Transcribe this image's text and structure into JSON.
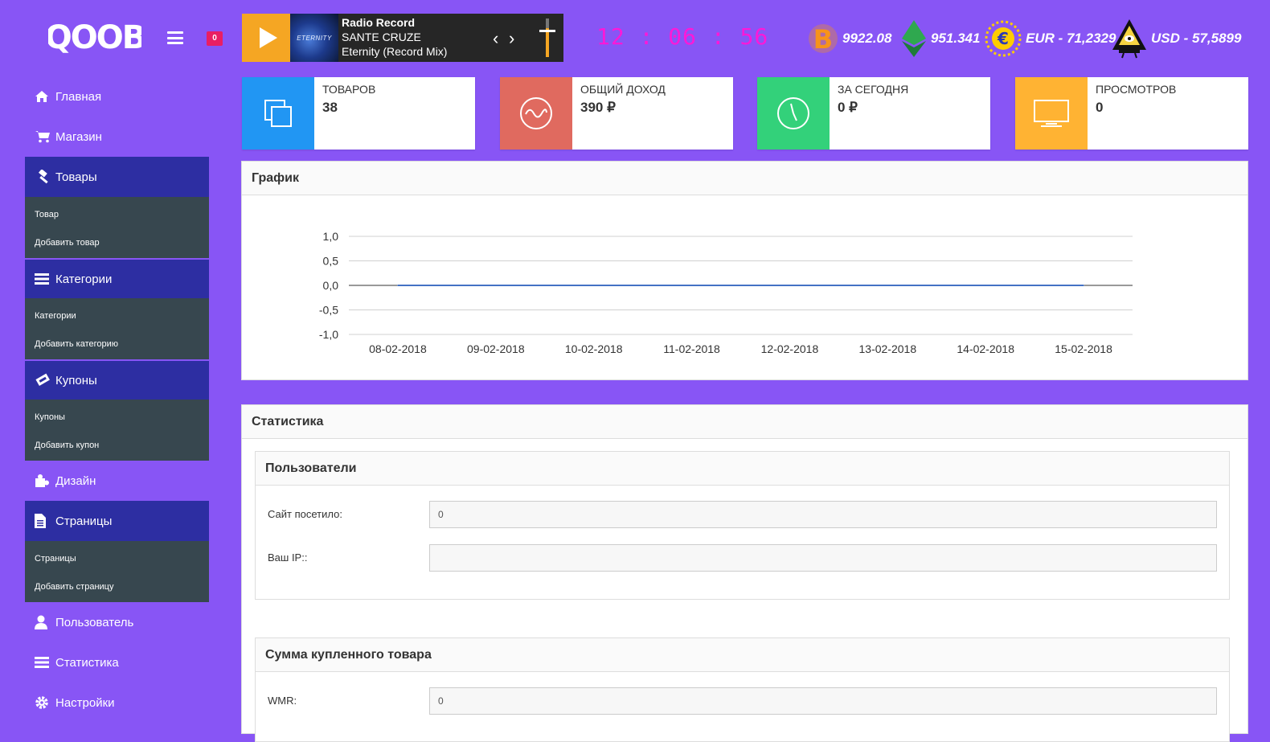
{
  "header": {
    "logo": "QOOB",
    "notification_count": "0",
    "player": {
      "station": "Radio Record",
      "artist": "SANTE CRUZE",
      "title": "Eternity (Record Mix)",
      "cover_text": "ETERNITY",
      "volume_level": 0.74
    },
    "clock": "12 : 06 : 56",
    "rates": [
      {
        "name": "bitcoin-icon",
        "value": "9922.08"
      },
      {
        "name": "ethereum-icon",
        "value": "951.341"
      },
      {
        "name": "euro-icon",
        "value": "EUR - 71,2329"
      },
      {
        "name": "usd-icon",
        "value": "USD - 57,5899"
      }
    ]
  },
  "sidebar": {
    "items": [
      {
        "icon": "home-icon",
        "label": "Главная",
        "active": false
      },
      {
        "icon": "cart-icon",
        "label": "Магазин",
        "active": false
      },
      {
        "icon": "gavel-icon",
        "label": "Товары",
        "active": true,
        "children": [
          "Товар",
          "Добавить товар"
        ]
      },
      {
        "icon": "list-icon",
        "label": "Категории",
        "active": true,
        "children": [
          "Категории",
          "Добавить категорию"
        ]
      },
      {
        "icon": "ticket-icon",
        "label": "Купоны",
        "active": true,
        "children": [
          "Купоны",
          "Добавить купон"
        ]
      },
      {
        "icon": "puzzle-icon",
        "label": "Дизайн",
        "active": false
      },
      {
        "icon": "file-icon",
        "label": "Страницы",
        "active": true,
        "children": [
          "Страницы",
          "Добавить страницу"
        ]
      },
      {
        "icon": "user-icon",
        "label": "Пользователь",
        "active": false
      },
      {
        "icon": "bars-icon",
        "label": "Статистика",
        "active": false
      },
      {
        "icon": "gear-icon",
        "label": "Настройки",
        "active": false
      }
    ]
  },
  "info_boxes": [
    {
      "label": "ТОВАРОВ",
      "value": "38",
      "color": "#2196f3",
      "icon": "copy-icon"
    },
    {
      "label": "ОБЩИЙ ДОХОД",
      "value": "390 ₽",
      "color": "#e06a5f",
      "icon": "wave-icon"
    },
    {
      "label": "ЗА СЕГОДНЯ",
      "value": "0 ₽",
      "color": "#33d17a",
      "icon": "clock-icon"
    },
    {
      "label": "ПРОСМОТРОВ",
      "value": "0",
      "color": "#ffb333",
      "icon": "monitor-icon"
    }
  ],
  "chart_panel": {
    "title": "График",
    "chart_data": {
      "type": "line",
      "x": [
        "08-02-2018",
        "09-02-2018",
        "10-02-2018",
        "11-02-2018",
        "12-02-2018",
        "13-02-2018",
        "14-02-2018",
        "15-02-2018"
      ],
      "series": [
        {
          "values": [
            0,
            0,
            0,
            0,
            0,
            0,
            0,
            0
          ],
          "color": "#4472c4"
        }
      ],
      "y_ticks": [
        "1,0",
        "0,5",
        "0,0",
        "-0,5",
        "-1,0"
      ],
      "ylim": [
        -1,
        1
      ],
      "grid": true
    }
  },
  "stats_panel": {
    "title": "Статистика",
    "users": {
      "title": "Пользователи",
      "visited_label": "Сайт посетило:",
      "visited_value": "0",
      "ip_label": "Ваш IP::",
      "ip_value": ""
    },
    "purchases": {
      "title": "Сумма купленного товара",
      "wmr_label": "WMR:",
      "wmr_value": "0"
    }
  }
}
